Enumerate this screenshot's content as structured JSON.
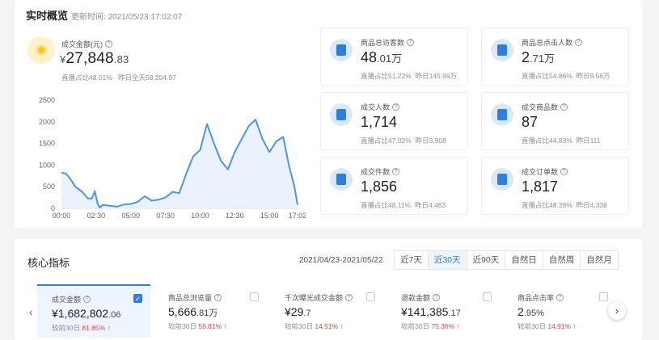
{
  "overview": {
    "title": "实时概览",
    "update_label": "更新时间:",
    "update_time": "2021/05/23 17:02:07",
    "main_metric": {
      "label": "成交金额(元)",
      "currency": "¥",
      "value_int": "27,848",
      "value_dec": ".83",
      "live_share_label": "直播占比",
      "live_share": "48.01%",
      "yesterday_label": "昨日全天",
      "yesterday": "58,204.97"
    },
    "stats": [
      {
        "label": "商品总访客数",
        "value": "48",
        "value_small": ".01万",
        "live_share": "直播占比51.22%",
        "yesterday": "昨日145.99万",
        "icon": "visitor-icon"
      },
      {
        "label": "商品总点击人数",
        "value": "2",
        "value_small": ".71万",
        "live_share": "直播占比54.86%",
        "yesterday": "昨日9.56万",
        "icon": "click-icon"
      },
      {
        "label": "成交人数",
        "value": "1,714",
        "value_small": "",
        "live_share": "直播占比47.02%",
        "yesterday": "昨日3,908",
        "icon": "buyer-icon"
      },
      {
        "label": "成交商品数",
        "value": "87",
        "value_small": "",
        "live_share": "直播占比44.83%",
        "yesterday": "昨日111",
        "icon": "product-icon"
      },
      {
        "label": "成交件数",
        "value": "1,856",
        "value_small": "",
        "live_share": "直播占比48.11%",
        "yesterday": "昨日4,463",
        "icon": "bag-icon"
      },
      {
        "label": "成交订单数",
        "value": "1,817",
        "value_small": "",
        "live_share": "直播占比48.38%",
        "yesterday": "昨日4,338",
        "icon": "order-icon"
      }
    ]
  },
  "chart_data": {
    "type": "area",
    "x_ticks": [
      "00:00",
      "02:30",
      "05:00",
      "07:30",
      "10:00",
      "12:30",
      "15:00",
      "17:02"
    ],
    "y_ticks": [
      0,
      500,
      1000,
      1500,
      2000,
      2500
    ],
    "ylim": [
      0,
      2500
    ],
    "x_hours": [
      0,
      0.3,
      0.6,
      1.0,
      1.5,
      1.9,
      2.2,
      2.4,
      2.6,
      2.75,
      3.0,
      3.5,
      4.0,
      4.5,
      5.0,
      5.5,
      6.0,
      6.5,
      7.0,
      7.5,
      8.0,
      8.5,
      9.0,
      9.5,
      10.0,
      10.5,
      11.0,
      11.5,
      12.0,
      12.5,
      13.0,
      13.5,
      14.0,
      14.5,
      15.0,
      15.5,
      16.0,
      16.4,
      16.8,
      17.03
    ],
    "values": [
      820,
      810,
      700,
      500,
      380,
      230,
      230,
      400,
      120,
      20,
      80,
      60,
      40,
      90,
      100,
      150,
      280,
      180,
      200,
      250,
      380,
      350,
      800,
      1200,
      1350,
      1950,
      1500,
      1100,
      900,
      1300,
      1600,
      1900,
      2050,
      1600,
      1300,
      1550,
      1650,
      1000,
      500,
      80
    ],
    "line_color": "#4f93e8",
    "fill_color": "#dbe9fb"
  },
  "core": {
    "title": "核心指标",
    "date_range": "2021/04/23-2021/05/22",
    "tabs": [
      "近7天",
      "近30天",
      "近90天",
      "自然日",
      "自然周",
      "自然月"
    ],
    "active_tab": 1,
    "kpis": [
      {
        "label": "成交金额",
        "value": "¥1,682,802",
        "value_small": ".06",
        "cmp": "较前30日",
        "pct": "81.85%",
        "checked": true
      },
      {
        "label": "商品总浏览量",
        "value": "5,666",
        "value_small": ".81万",
        "cmp": "较前30日",
        "pct": "58.81%",
        "checked": false
      },
      {
        "label": "千次曝光成交金额",
        "value": "¥29",
        "value_small": ".7",
        "cmp": "较前30日",
        "pct": "14.51%",
        "checked": false
      },
      {
        "label": "退款金额",
        "value": "¥141,385",
        "value_small": ".17",
        "cmp": "较前30日",
        "pct": "75.36%",
        "checked": false
      },
      {
        "label": "商品点击率",
        "value": "2",
        "value_small": ".95%",
        "cmp": "较前30日",
        "pct": "14.91%",
        "checked": false
      }
    ],
    "up_arrow": "↑"
  }
}
